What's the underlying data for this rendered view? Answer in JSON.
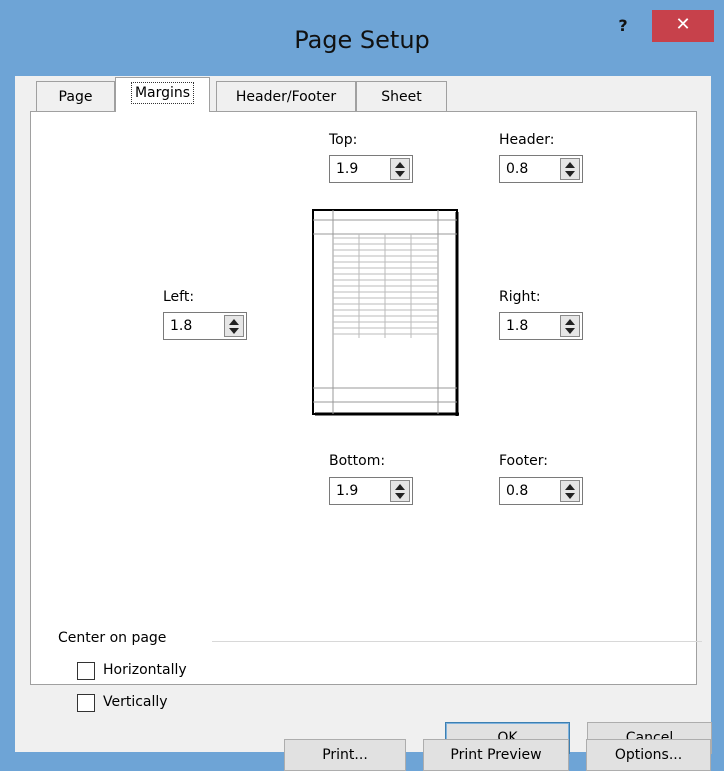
{
  "window": {
    "title": "Page Setup",
    "help_label": "?",
    "close_label": "✕"
  },
  "tabs": [
    {
      "label": "Page",
      "active": false
    },
    {
      "label": "Margins",
      "active": true
    },
    {
      "label": "Header/Footer",
      "active": false
    },
    {
      "label": "Sheet",
      "active": false
    }
  ],
  "margins": {
    "top": {
      "label": "Top:",
      "value": "1.9"
    },
    "header": {
      "label": "Header:",
      "value": "0.8"
    },
    "left": {
      "label": "Left:",
      "value": "1.8"
    },
    "right": {
      "label": "Right:",
      "value": "1.8"
    },
    "bottom": {
      "label": "Bottom:",
      "value": "1.9"
    },
    "footer": {
      "label": "Footer:",
      "value": "0.8"
    }
  },
  "center_on_page": {
    "heading": "Center on page",
    "horizontally": {
      "label": "Horizontally",
      "checked": false
    },
    "vertically": {
      "label": "Vertically",
      "checked": false
    }
  },
  "panel_buttons": {
    "print": "Print...",
    "print_preview": "Print Preview",
    "options": "Options..."
  },
  "dialog_buttons": {
    "ok": "OK",
    "cancel": "Cancel"
  },
  "icons": {
    "help": "help-icon",
    "close": "close-icon",
    "spin_up": "spin-up-icon",
    "spin_down": "spin-down-icon"
  }
}
